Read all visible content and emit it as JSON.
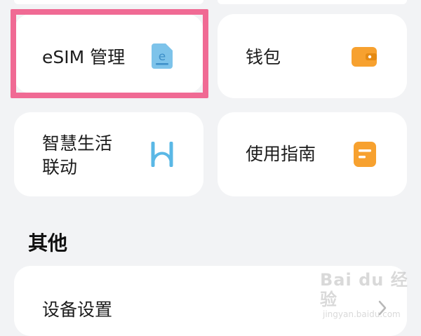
{
  "cards": {
    "esim": {
      "label": "eSIM 管理",
      "icon": "esim-icon",
      "icon_letter": "e",
      "icon_color": "#7dc3ea"
    },
    "wallet": {
      "label": "钱包",
      "icon": "wallet-icon",
      "icon_color": "#f7a12f"
    },
    "smart_life": {
      "label": "智慧生活\n联动",
      "icon": "smart-life-icon",
      "icon_color": "#5ab8e6"
    },
    "guide": {
      "label": "使用指南",
      "icon": "guide-icon",
      "icon_color": "#f7a12f"
    }
  },
  "section": {
    "title": "其他"
  },
  "list": {
    "items": [
      {
        "label": "设备设置",
        "icon": "chevron-right-icon"
      }
    ]
  },
  "watermark": {
    "brand": "Bai du 经验",
    "url": "jingyan.baidu.com"
  },
  "colors": {
    "background": "#f2f3f5",
    "card": "#ffffff",
    "highlight": "#f06a94",
    "accent_orange": "#f7a12f",
    "accent_blue": "#7dc3ea"
  }
}
